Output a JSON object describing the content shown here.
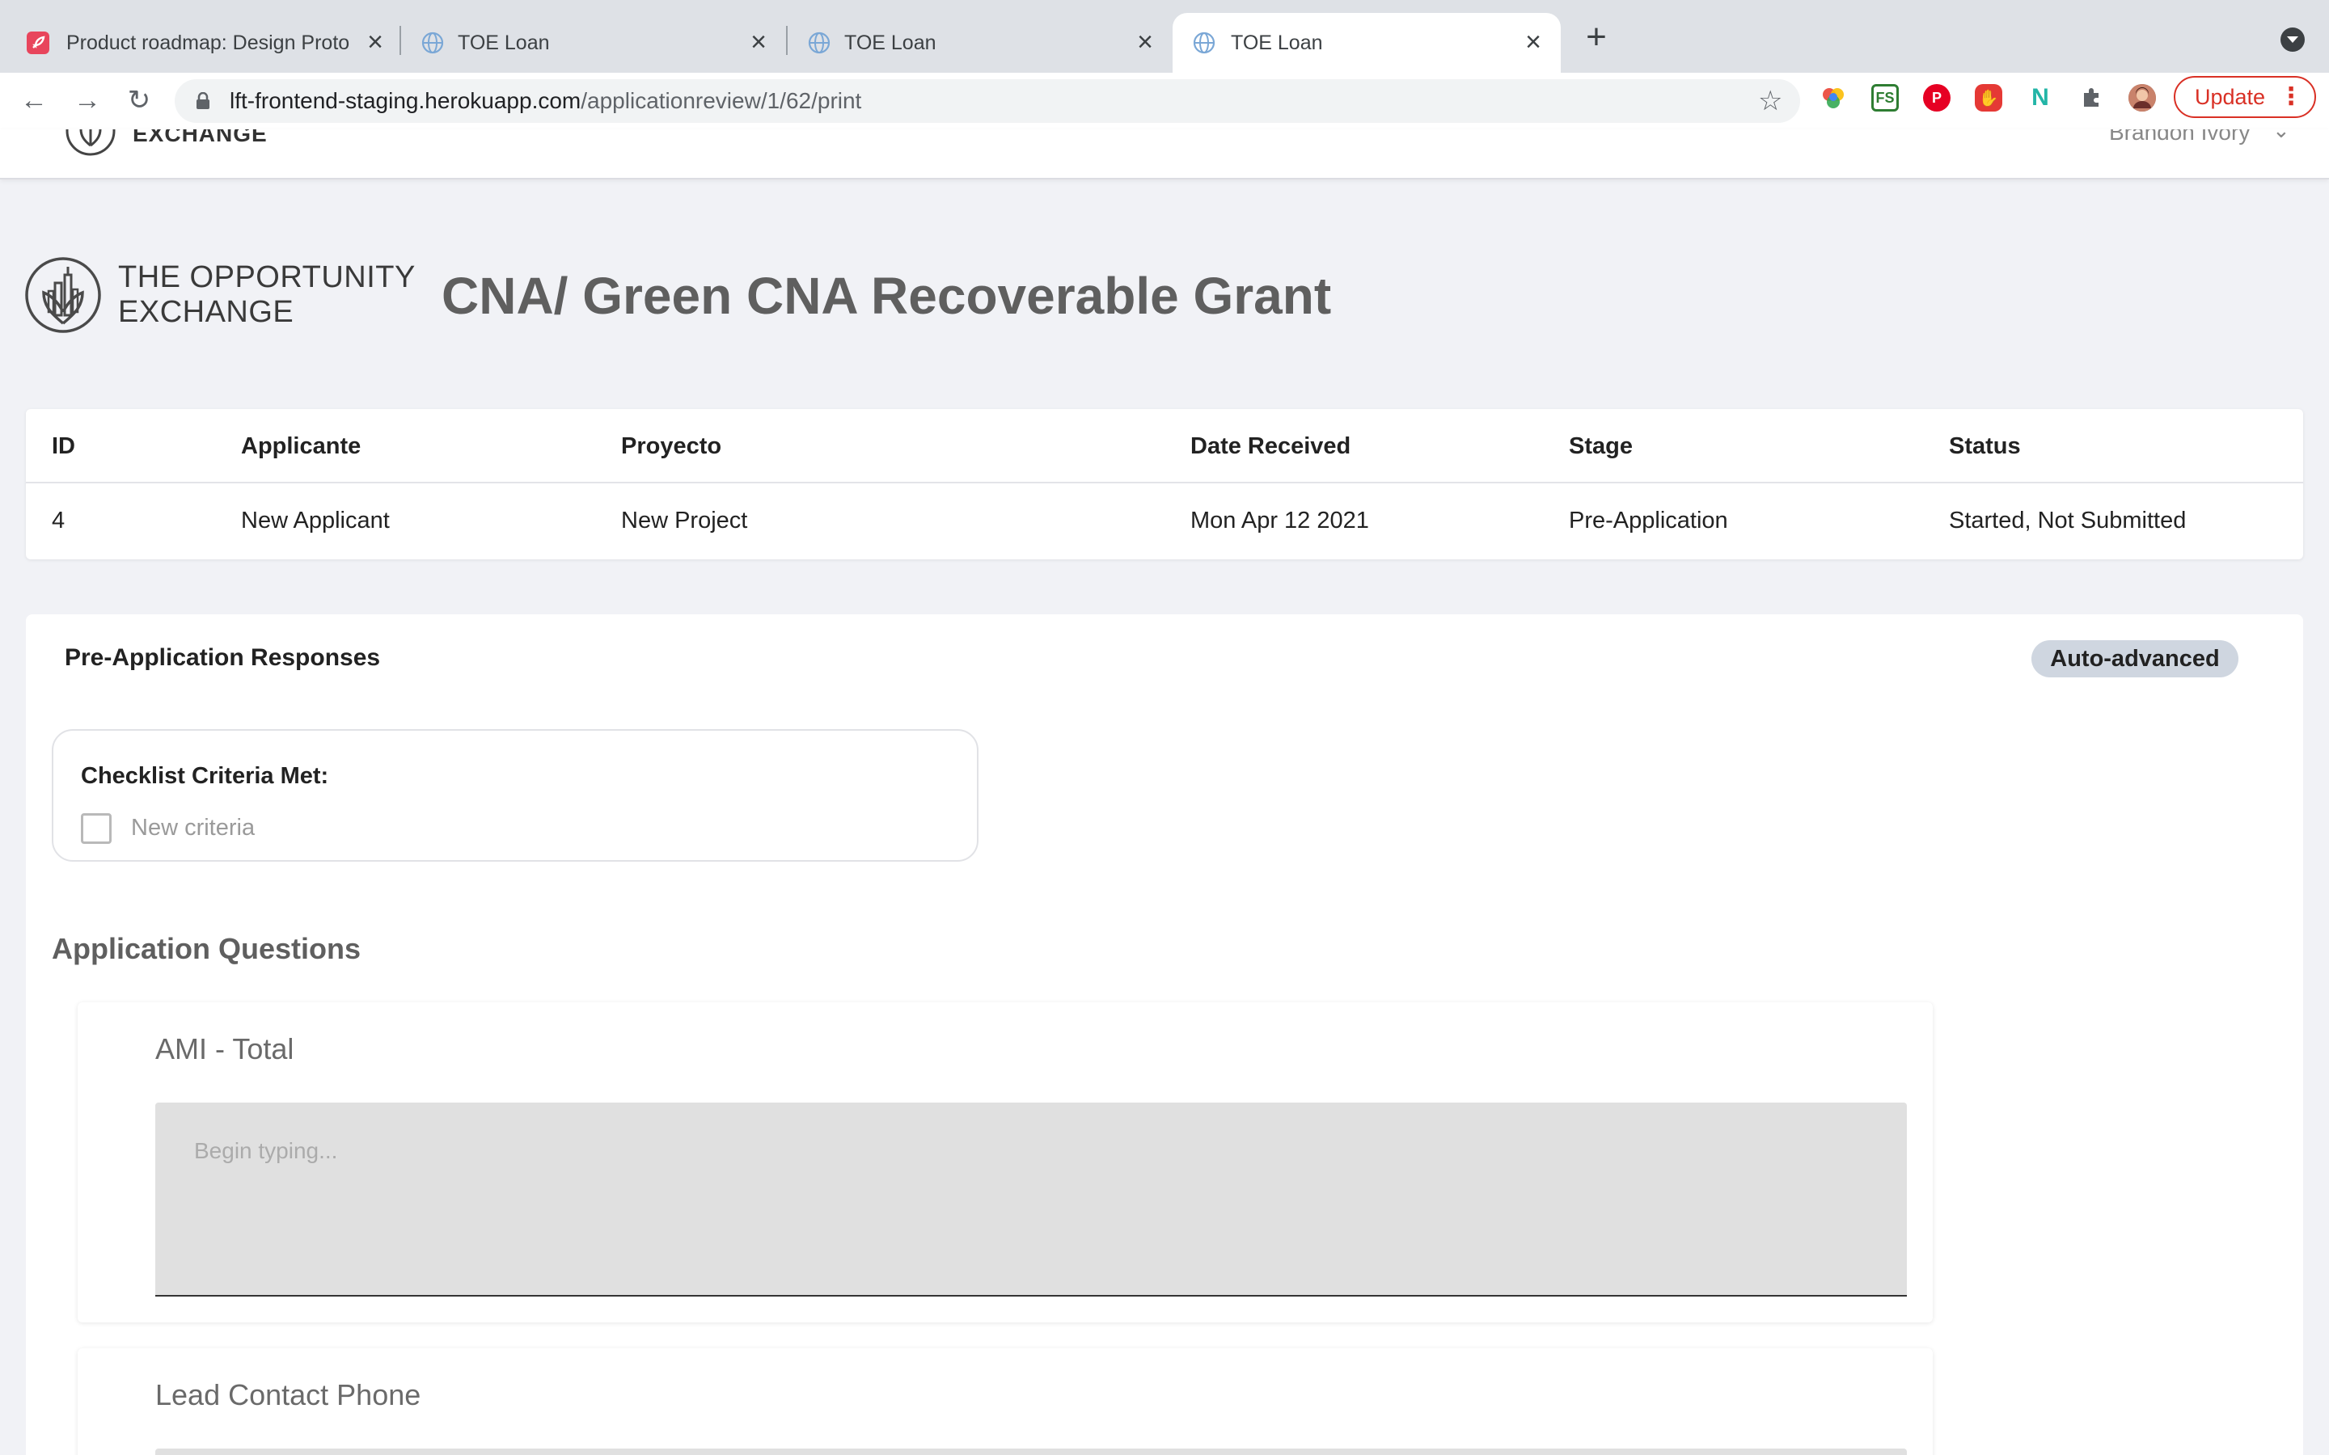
{
  "browser": {
    "tabs": [
      {
        "title": "Product roadmap: Design Proto",
        "favicon": "rocket-favicon",
        "active": false
      },
      {
        "title": "TOE Loan",
        "favicon": "globe-favicon",
        "active": false
      },
      {
        "title": "TOE Loan",
        "favicon": "globe-favicon",
        "active": false
      },
      {
        "title": "TOE Loan",
        "favicon": "globe-favicon",
        "active": true
      }
    ],
    "new_tab": "+",
    "close_glyph": "×",
    "url_host": "lft-frontend-staging.herokuapp.com",
    "url_path": "/applicationreview/1/62/print",
    "update_label": "Update",
    "extensions": [
      {
        "name": "color-wheel-icon",
        "label": "",
        "color": "#4285f4"
      },
      {
        "name": "fs-extension-icon",
        "label": "FS",
        "color": "#2e7d32"
      },
      {
        "name": "pinterest-icon",
        "label": "P",
        "color": "#e60023"
      },
      {
        "name": "adblock-icon",
        "label": "✋",
        "color": "#e53935"
      },
      {
        "name": "n-extension-icon",
        "label": "N",
        "color": "#23b5a7"
      },
      {
        "name": "puzzle-extensions-icon",
        "label": "",
        "color": "#5f6368"
      },
      {
        "name": "profile-avatar",
        "label": "",
        "color": "#8d5a4a"
      }
    ]
  },
  "header": {
    "logo_text": "EXCHANGE",
    "user_name": "Brandon Ivory",
    "caret": "⌄"
  },
  "brand": {
    "line1": "THE OPPORTUNITY",
    "line2": "EXCHANGE"
  },
  "page_title": "CNA/ Green CNA Recoverable Grant",
  "summary": {
    "columns": [
      "ID",
      "Applicante",
      "Proyecto",
      "Date Received",
      "Stage",
      "Status"
    ],
    "row": [
      "4",
      "New Applicant",
      "New Project",
      "Mon Apr 12 2021",
      "Pre-Application",
      "Started, Not Submitted"
    ]
  },
  "responses": {
    "title": "Pre-Application Responses",
    "badge": "Auto-advanced",
    "checklist_title": "Checklist Criteria Met:",
    "criteria": [
      {
        "label": "New criteria",
        "checked": false
      }
    ]
  },
  "questions": {
    "heading": "Application Questions",
    "items": [
      {
        "label": "AMI - Total",
        "placeholder": "Begin typing..."
      },
      {
        "label": "Lead Contact Phone",
        "placeholder": ""
      }
    ]
  },
  "colors": {
    "page_bg": "#f1f2f6",
    "badge_bg": "#cfd6e0",
    "update_red": "#d93025",
    "title_gray": "#5f5f5f"
  }
}
